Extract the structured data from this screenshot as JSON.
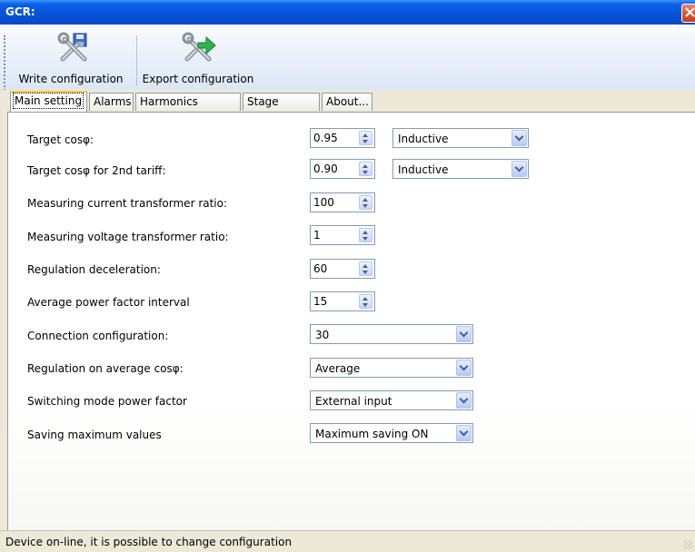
{
  "window": {
    "title": "GCR:"
  },
  "toolbar": {
    "write_label": "Write configuration",
    "export_label": "Export configuration"
  },
  "tabs": [
    {
      "label": "Main setting",
      "active": true
    },
    {
      "label": "Alarms"
    },
    {
      "label": "Harmonics setting"
    },
    {
      "label": "Stage setting"
    },
    {
      "label": "About..."
    }
  ],
  "main": {
    "target_cos": {
      "label": "Target cosφ:",
      "value": "0.95",
      "type": "Inductive"
    },
    "target_cos_2nd": {
      "label": "Target cosφ for 2nd tariff:",
      "value": "0.90",
      "type": "Inductive"
    },
    "current_ratio": {
      "label": "Measuring current transformer ratio:",
      "value": "100"
    },
    "voltage_ratio": {
      "label": "Measuring voltage transformer ratio:",
      "value": "1"
    },
    "regulation_decel": {
      "label": "Regulation deceleration:",
      "value": "60"
    },
    "avg_pf_interval": {
      "label": "Average power factor interval",
      "value": "15"
    },
    "connection_config": {
      "label": "Connection configuration:",
      "value": "30"
    },
    "regulation_avg": {
      "label": "Regulation on average cosφ:",
      "value": "Average"
    },
    "switching_mode": {
      "label": "Switching mode power factor",
      "value": "External input"
    },
    "saving_max": {
      "label": "Saving maximum values",
      "value": "Maximum saving ON"
    }
  },
  "status": {
    "text": "Device on-line, it is possible to change configuration"
  },
  "colors": {
    "titlebar": "#0554d6",
    "toolbar": "#dbe6f6",
    "tab_active_accent": "#ffc83c",
    "chrome": "#ece9d8"
  }
}
